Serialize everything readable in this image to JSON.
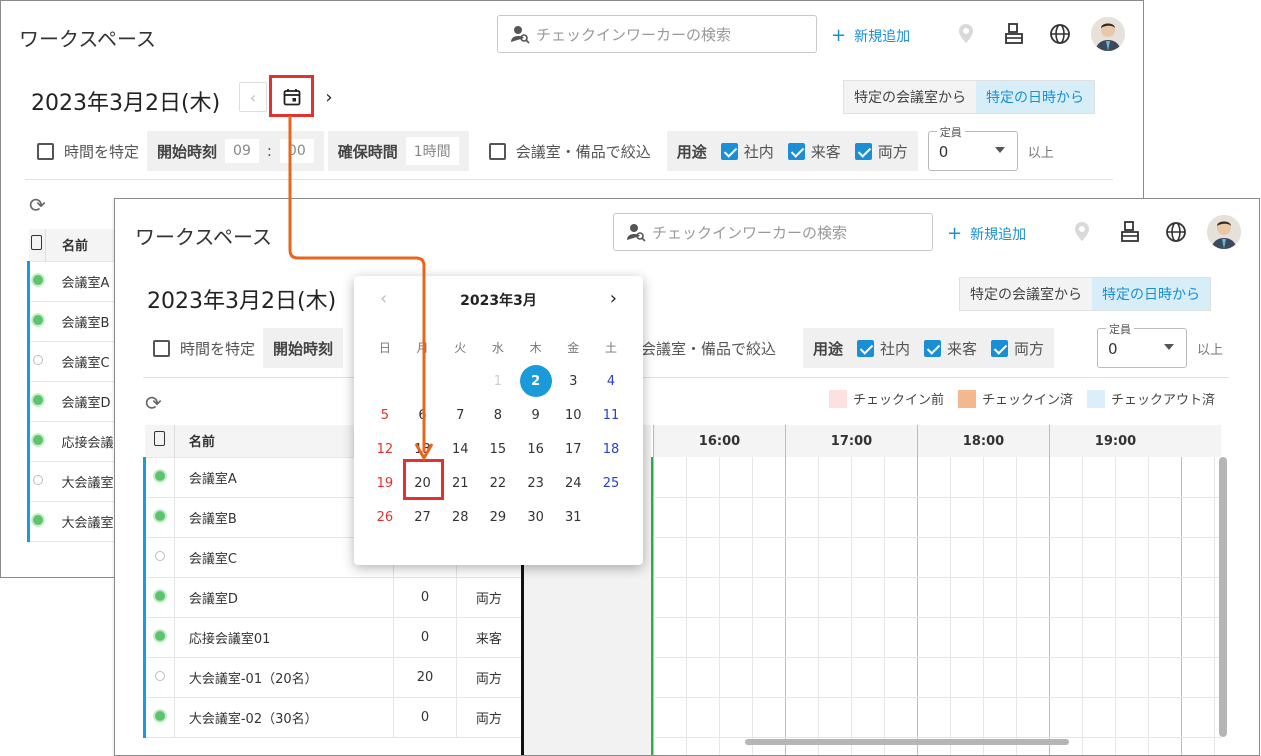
{
  "app": {
    "title": "ワークスペース",
    "search_placeholder": "チェックインワーカーの検索",
    "add_label": "新規追加"
  },
  "date_title": "2023年3月2日(木)",
  "mode": {
    "by_room": "特定の会議室から",
    "by_datetime": "特定の日時から"
  },
  "filters": {
    "specify_time": "時間を特定",
    "start_time_label": "開始時刻",
    "start_hour": "09",
    "start_min": "00",
    "time_sep": ":",
    "duration_label": "確保時間",
    "duration_value": "1時間",
    "narrow_by_equipment": "会議室・備品で絞込",
    "purpose_label": "用途",
    "purpose_internal": "社内",
    "purpose_guest": "来客",
    "purpose_both": "両方",
    "capacity_legend": "定員",
    "capacity_value": "0",
    "capacity_suffix": "以上"
  },
  "legend": {
    "before_checkin": "チェックイン前",
    "checked_in": "チェックイン済",
    "checked_out": "チェックアウト済"
  },
  "table": {
    "col_name": "名前",
    "rows": [
      {
        "name": "会議室A",
        "status": "green"
      },
      {
        "name": "会議室B",
        "status": "green"
      },
      {
        "name": "会議室C",
        "status": "white"
      },
      {
        "name": "会議室D",
        "status": "green",
        "capacity": "0",
        "purpose": "両方"
      },
      {
        "name": "応接会議室01",
        "status": "green",
        "capacity": "0",
        "purpose": "来客"
      },
      {
        "name": "大会議室-01（20名）",
        "status": "white",
        "capacity": "20",
        "purpose": "両方"
      },
      {
        "name": "大会議室-02（30名）",
        "status": "green",
        "capacity": "0",
        "purpose": "両方"
      }
    ],
    "back_rows": [
      "会議室A",
      "会議室B",
      "会議室C",
      "会議室D",
      "応接会議室",
      "大会議室",
      "大会議室"
    ]
  },
  "timeline": {
    "hours": [
      "16:00",
      "17:00",
      "18:00",
      "19:00"
    ]
  },
  "calendar": {
    "month_title": "2023年3月",
    "weekdays": [
      "日",
      "月",
      "火",
      "水",
      "木",
      "金",
      "土"
    ],
    "days": [
      "",
      "",
      "",
      "1",
      "2",
      "3",
      "4",
      "5",
      "6",
      "7",
      "8",
      "9",
      "10",
      "11",
      "12",
      "13",
      "14",
      "15",
      "16",
      "17",
      "18",
      "19",
      "20",
      "21",
      "22",
      "23",
      "24",
      "25",
      "26",
      "27",
      "28",
      "29",
      "30",
      "31"
    ],
    "selected_day": "2",
    "highlighted_day": "20"
  },
  "colors": {
    "accent": "#1a8fd6",
    "annotation": "#e0322f",
    "arrow": "#e8661c",
    "before_checkin": "#fde0e0",
    "checked_in": "#f4b890",
    "checked_out": "#dceef9"
  }
}
